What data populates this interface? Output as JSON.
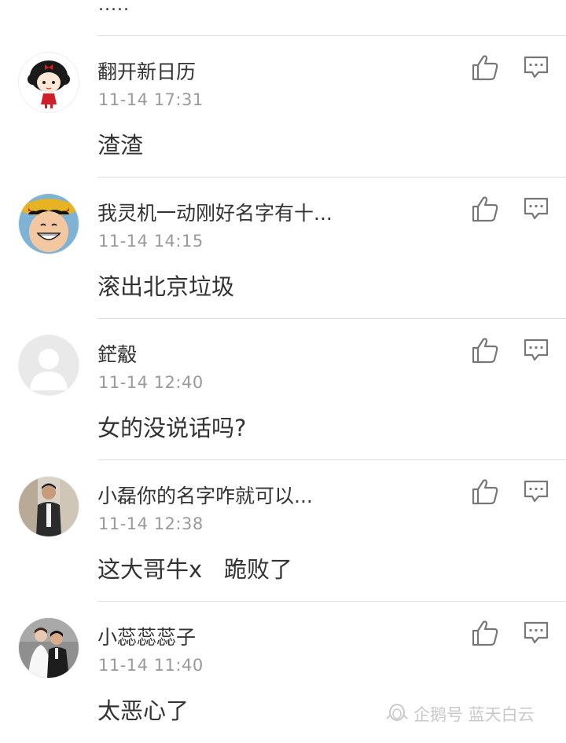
{
  "top_fragment": ".....",
  "comments": [
    {
      "username": "翻开新日历",
      "time": "11-14 17:31",
      "content": "渣渣",
      "avatar": "cartoon-girl-avatar"
    },
    {
      "username": "我灵机一动刚好名字有十...",
      "time": "11-14 14:15",
      "content": "滚出北京垃圾",
      "avatar": "luffy-avatar"
    },
    {
      "username": "鋩觳",
      "time": "11-14 12:40",
      "content": "女的没说话吗?",
      "avatar": "default-avatar"
    },
    {
      "username": "小磊你的名字咋就可以...",
      "time": "11-14 12:38",
      "content": "这大哥牛x   跪败了",
      "avatar": "photo-avatar"
    },
    {
      "username": "小蕊蕊蕊子",
      "time": "11-14 11:40",
      "content": "太恶心了",
      "avatar": "wedding-photo-avatar"
    }
  ],
  "icons": {
    "like": "thumbs-up-icon",
    "reply": "comment-icon"
  },
  "colors": {
    "text": "#333333",
    "time": "#9a9a9a",
    "divider": "#dcdcdc",
    "icon": "#777777",
    "watermark": "#c9c9c9"
  },
  "watermark": "企鹅号 蓝天白云"
}
